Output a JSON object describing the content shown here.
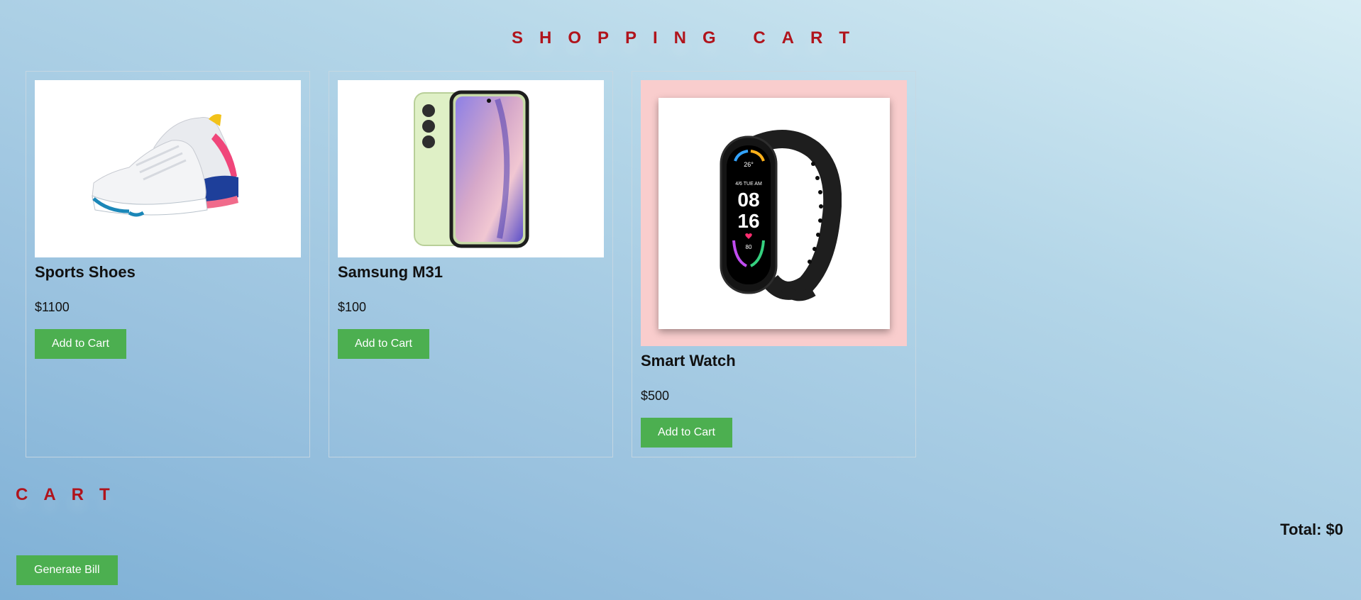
{
  "page_title": "SHOPPING CART",
  "products": [
    {
      "name": "Sports Shoes",
      "price": "$1100",
      "button": "Add to Cart",
      "image_icon": "sneaker-icon"
    },
    {
      "name": "Samsung M31",
      "price": "$100",
      "button": "Add to Cart",
      "image_icon": "smartphone-icon"
    },
    {
      "name": "Smart Watch",
      "price": "$500",
      "button": "Add to Cart",
      "image_icon": "smart-band-icon",
      "watch_face": {
        "date": "4/6 TUE AM",
        "hour": "08",
        "minute": "16",
        "temp": "26°",
        "heart": "80"
      }
    }
  ],
  "cart": {
    "title": "CART",
    "total": "Total: $0",
    "generate_bill": "Generate Bill"
  },
  "colors": {
    "accent_red": "#b0141c",
    "button_green": "#4caf50",
    "highlight_pink": "#f9cdcd"
  }
}
